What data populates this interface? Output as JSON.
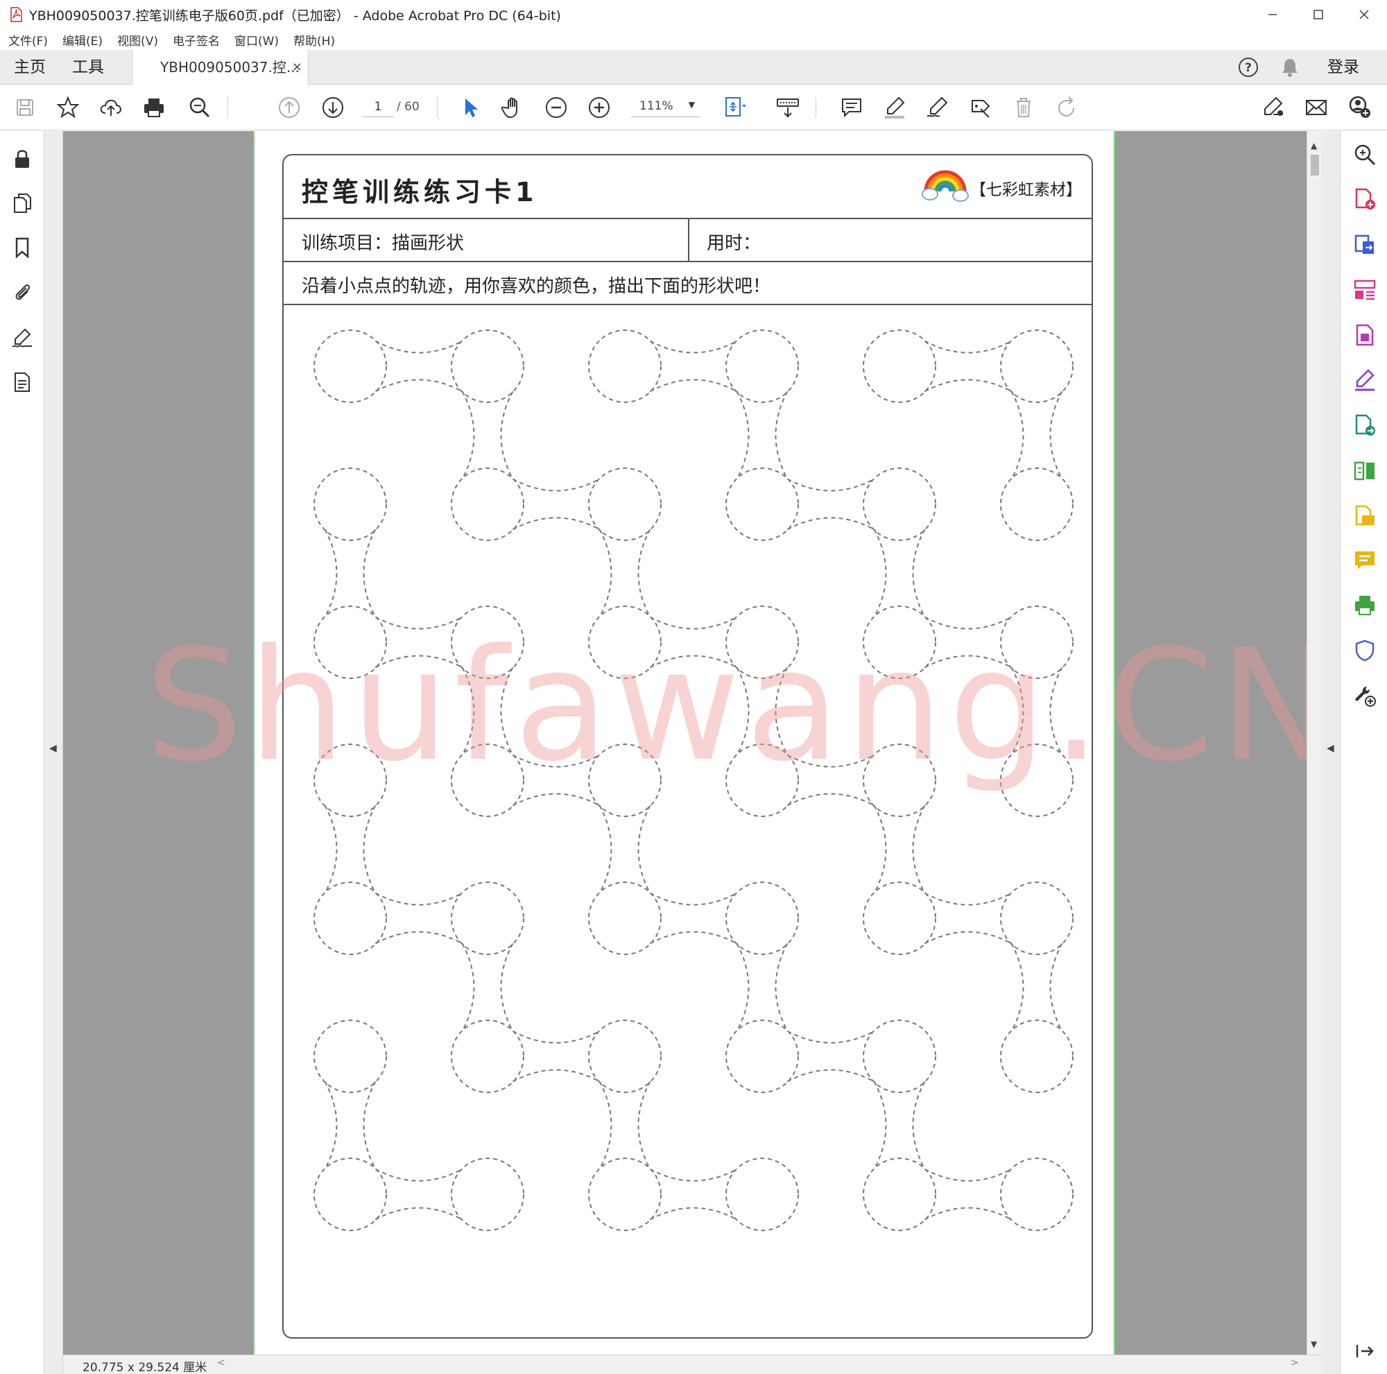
{
  "window": {
    "title": "YBH009050037.控笔训练电子版60页.pdf（已加密） - Adobe Acrobat Pro DC (64-bit)",
    "minimize_icon": "minimize-icon",
    "maximize_icon": "maximize-icon",
    "close_icon": "close-icon"
  },
  "menu": [
    "文件(F)",
    "编辑(E)",
    "视图(V)",
    "电子签名",
    "窗口(W)",
    "帮助(H)"
  ],
  "tabs": {
    "home": "主页",
    "tools": "工具",
    "document": "YBH009050037.控...",
    "close": "×",
    "login": "登录"
  },
  "toolbar": {
    "page_current": "1",
    "page_total": "/ 60",
    "zoom": "111%",
    "zoom_arrow": "▼"
  },
  "document": {
    "card_title": "控笔训练练习卡1",
    "brand": "【七彩虹素材】",
    "project_label": "训练项目：描画形状",
    "time_label": "用时：",
    "instruction": "沿着小点点的轨迹，用你喜欢的颜色，描出下面的形状吧！",
    "watermark": "Shufawang.CN"
  },
  "left_collapse_arrow": "◀",
  "right_collapse_arrow": "◀",
  "scroll": {
    "up": "▲",
    "down": "▼"
  },
  "status": {
    "dimensions": "20.775 x 29.524 厘米",
    "left_arrow": "<",
    "right_arrow": ">"
  },
  "colors": {
    "pdf_red": "#e02020",
    "selected_blue": "#2b6fd3",
    "page_border_green": "#7cd67c",
    "watermark": "#ee9696",
    "tool_red": "#e0324b",
    "tool_blue": "#3d5bd9",
    "tool_pink": "#d63a8a",
    "tool_magenta": "#b53ab5",
    "tool_purple": "#8a3ad6",
    "tool_teal": "#1e8f7a",
    "tool_green": "#3fa33f",
    "tool_yellow": "#e8b614",
    "tool_shield": "#4b5bd6",
    "tool_gray": "#333333"
  }
}
